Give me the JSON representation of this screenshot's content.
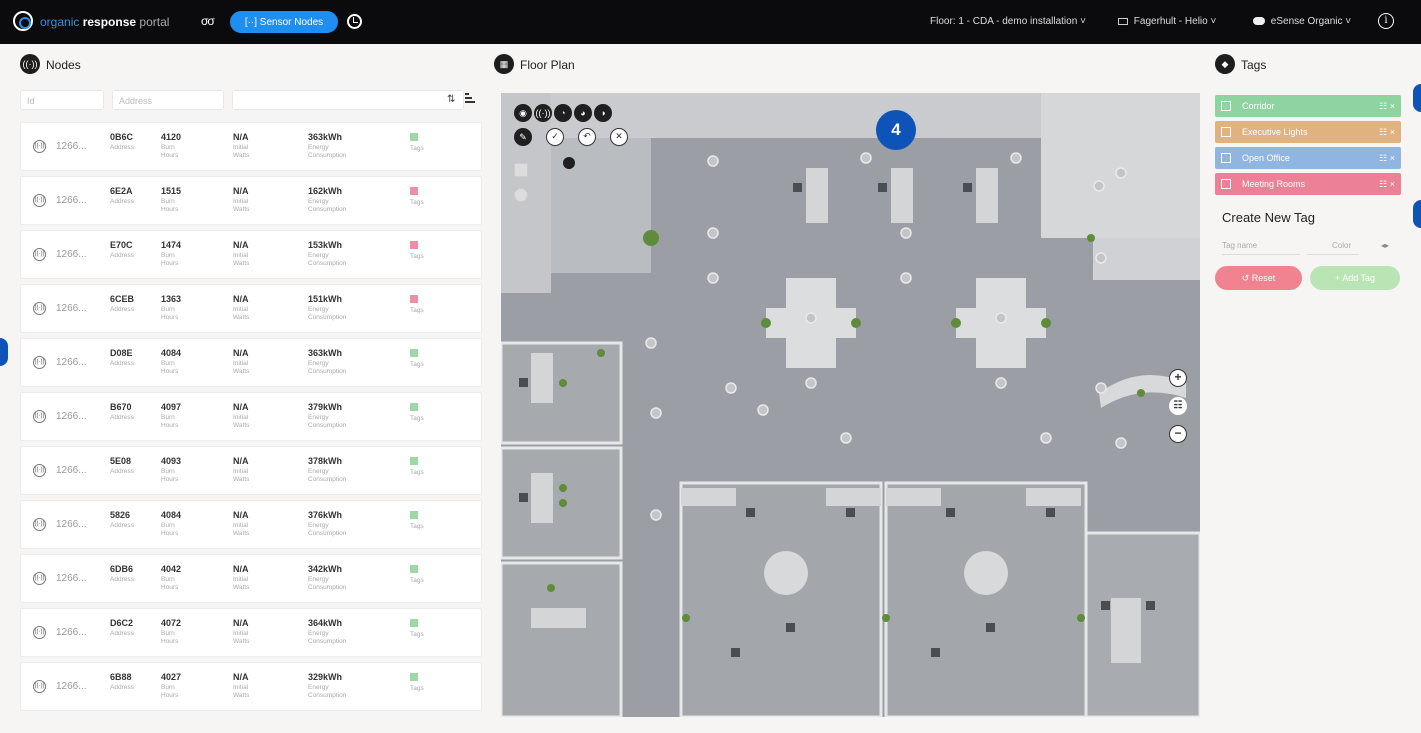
{
  "topbar": {
    "brand_a": "organic",
    "brand_b": "response",
    "brand_c": "portal",
    "glasses_glyph": "σσ",
    "sensor_nodes_label": "[··] Sensor Nodes",
    "floor_selector": "Floor: 1 - CDA - demo installation",
    "brand_selector": "Fagerhult - Helio",
    "product_selector": "eSense Organic",
    "caret": "˅",
    "info_glyph": "i"
  },
  "nodes_panel": {
    "title": "Nodes",
    "filter_id": "Id",
    "filter_address": "Address",
    "filter_extra": "",
    "rows": [
      {
        "id": "1266...",
        "address": "0B6C",
        "address_label": "Address",
        "burn": "4120",
        "burn_label": "Burn Hours",
        "watt": "N/A",
        "watt_label": "Initial Watts",
        "energy": "363kWh",
        "energy_label": "Energy Consumption",
        "tag_color": "#9ed8a6",
        "tag_label": "Tags"
      },
      {
        "id": "1266...",
        "address": "6E2A",
        "address_label": "Address",
        "burn": "1515",
        "burn_label": "Burn Hours",
        "watt": "N/A",
        "watt_label": "Initial Watts",
        "energy": "162kWh",
        "energy_label": "Energy Consumption",
        "tag_color": "#ef8fa5",
        "tag_label": "Tags"
      },
      {
        "id": "1266...",
        "address": "E70C",
        "address_label": "Address",
        "burn": "1474",
        "burn_label": "Burn Hours",
        "watt": "N/A",
        "watt_label": "Initial Watts",
        "energy": "153kWh",
        "energy_label": "Energy Consumption",
        "tag_color": "#ef8fa5",
        "tag_label": "Tags"
      },
      {
        "id": "1266...",
        "address": "6CEB",
        "address_label": "Address",
        "burn": "1363",
        "burn_label": "Burn Hours",
        "watt": "N/A",
        "watt_label": "Initial Watts",
        "energy": "151kWh",
        "energy_label": "Energy Consumption",
        "tag_color": "#ef8fa5",
        "tag_label": "Tags"
      },
      {
        "id": "1266...",
        "address": "D08E",
        "address_label": "Address",
        "burn": "4084",
        "burn_label": "Burn Hours",
        "watt": "N/A",
        "watt_label": "Initial Watts",
        "energy": "363kWh",
        "energy_label": "Energy Consumption",
        "tag_color": "#9ed8a6",
        "tag_label": "Tags"
      },
      {
        "id": "1266...",
        "address": "B670",
        "address_label": "Address",
        "burn": "4097",
        "burn_label": "Burn Hours",
        "watt": "N/A",
        "watt_label": "Initial Watts",
        "energy": "379kWh",
        "energy_label": "Energy Consumption",
        "tag_color": "#9ed8a6",
        "tag_label": "Tags"
      },
      {
        "id": "1266...",
        "address": "5E08",
        "address_label": "Address",
        "burn": "4093",
        "burn_label": "Burn Hours",
        "watt": "N/A",
        "watt_label": "Initial Watts",
        "energy": "378kWh",
        "energy_label": "Energy Consumption",
        "tag_color": "#9ed8a6",
        "tag_label": "Tags"
      },
      {
        "id": "1266...",
        "address": "5826",
        "address_label": "Address",
        "burn": "4084",
        "burn_label": "Burn Hours",
        "watt": "N/A",
        "watt_label": "Initial Watts",
        "energy": "376kWh",
        "energy_label": "Energy Consumption",
        "tag_color": "#9ed8a6",
        "tag_label": "Tags"
      },
      {
        "id": "1266...",
        "address": "6DB6",
        "address_label": "Address",
        "burn": "4042",
        "burn_label": "Burn Hours",
        "watt": "N/A",
        "watt_label": "Initial Watts",
        "energy": "342kWh",
        "energy_label": "Energy Consumption",
        "tag_color": "#9ed8a6",
        "tag_label": "Tags"
      },
      {
        "id": "1266...",
        "address": "D6C2",
        "address_label": "Address",
        "burn": "4072",
        "burn_label": "Burn Hours",
        "watt": "N/A",
        "watt_label": "Initial Watts",
        "energy": "364kWh",
        "energy_label": "Energy Consumption",
        "tag_color": "#9ed8a6",
        "tag_label": "Tags"
      },
      {
        "id": "1266...",
        "address": "6B88",
        "address_label": "Address",
        "burn": "4027",
        "burn_label": "Burn Hours",
        "watt": "N/A",
        "watt_label": "Initial Watts",
        "energy": "329kWh",
        "energy_label": "Energy Consumption",
        "tag_color": "#9ed8a6",
        "tag_label": "Tags"
      }
    ]
  },
  "floor_panel": {
    "title": "Floor Plan",
    "callout": "4",
    "zoom_in": "+",
    "zoom_fit": "☷",
    "zoom_out": "−"
  },
  "tags_panel": {
    "title": "Tags",
    "tags": [
      {
        "name": "Corridor",
        "color": "#8fd3a0",
        "actions": "☷ ×"
      },
      {
        "name": "Executive Lights",
        "color": "#e0b27f",
        "actions": "☷ ×"
      },
      {
        "name": "Open Office",
        "color": "#8fb5e0",
        "actions": "☷ ×"
      },
      {
        "name": "Meeting Rooms",
        "color": "#ec8096",
        "actions": "☷ ×"
      }
    ],
    "create_title": "Create New Tag",
    "name_placeholder": "Tag name",
    "color_placeholder": "Color",
    "reset_label": "↺ Reset",
    "add_label": "+ Add Tag",
    "reset_color": "#f0838f",
    "add_color": "#b9e4b4"
  }
}
